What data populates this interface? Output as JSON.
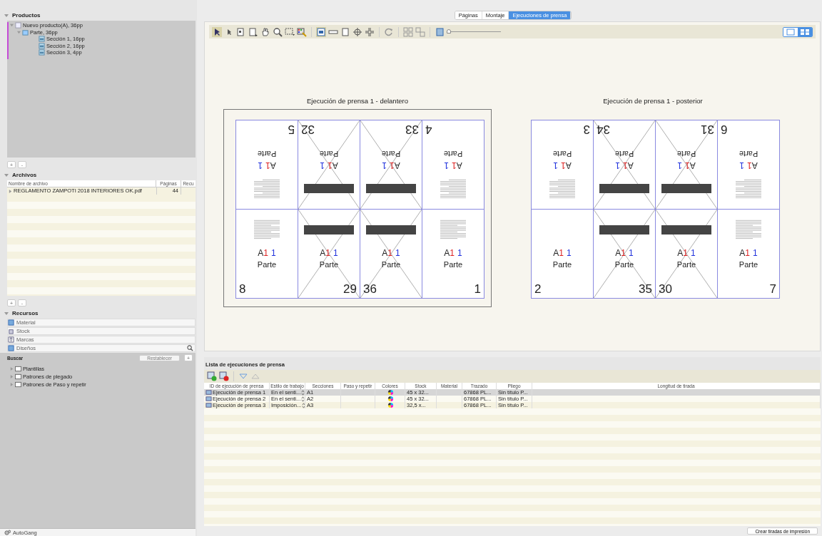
{
  "products": {
    "title": "Productos",
    "expanded": true,
    "items": [
      {
        "label": "Nuevo producto(A), 36pp",
        "expanded": true,
        "children": [
          {
            "label": "Parte, 36pp",
            "expanded": true,
            "children": [
              {
                "label": "Sección 1, 16pp"
              },
              {
                "label": "Sección 2, 16pp"
              },
              {
                "label": "Sección 3, 4pp"
              }
            ]
          }
        ]
      }
    ]
  },
  "products_buttons": [
    "+",
    "-"
  ],
  "files": {
    "title": "Archivos",
    "expanded": true,
    "columns": [
      "Nombre de archivo",
      "Páginas",
      "Recu"
    ],
    "rows": [
      {
        "name": "REGLAMENTO ZAMPOTI 2018 INTERIORES OK.pdf",
        "pages": "44"
      }
    ]
  },
  "files_buttons": [
    "+",
    "-"
  ],
  "resources": {
    "title": "Recursos",
    "expanded": true,
    "items": [
      {
        "label": "Material",
        "kind": "material"
      },
      {
        "label": "Stock",
        "kind": "stock"
      },
      {
        "label": "Marcas",
        "kind": "marks"
      },
      {
        "label": "Diseños",
        "kind": "designs"
      }
    ],
    "search_label": "Buscar",
    "reset_button": "Restablecer",
    "add_button": "+",
    "tree": [
      {
        "label": "Plantillas"
      },
      {
        "label": "Patrones de plegado"
      },
      {
        "label": "Patrones de Paso y repetir"
      }
    ]
  },
  "autogang": "AutoGang",
  "tabs": [
    {
      "label": "Páginas",
      "selected": false
    },
    {
      "label": "Montaje",
      "selected": false
    },
    {
      "label": "Ejecuciones de prensa",
      "selected": true
    }
  ],
  "zoom_slider": {
    "level": 0
  },
  "view_toggle": [
    {
      "kind": "single",
      "selected": false
    },
    {
      "kind": "grid",
      "selected": true
    }
  ],
  "sheets": [
    {
      "title": "Ejecución de prensa 1 - delantero",
      "selected": true,
      "rows": [
        {
          "rotated": true,
          "pages": [
            {
              "number": "5",
              "kind": "text",
              "part": "Parte",
              "signature": [
                "A",
                "1",
                "1"
              ]
            },
            {
              "number": "32",
              "kind": "blank",
              "part": "Parte",
              "signature": [
                "A",
                "1",
                "1"
              ]
            },
            {
              "number": "33",
              "kind": "blank",
              "part": "Parte",
              "signature": [
                "A",
                "1",
                "1"
              ]
            },
            {
              "number": "4",
              "kind": "text",
              "part": "Parte",
              "signature": [
                "A",
                "1",
                "1"
              ]
            }
          ]
        },
        {
          "rotated": false,
          "pages": [
            {
              "number": "8",
              "kind": "text",
              "part": "Parte",
              "signature": [
                "A",
                "1",
                "1"
              ]
            },
            {
              "number": "29",
              "kind": "blank",
              "part": "Parte",
              "signature": [
                "A",
                "1",
                "1"
              ]
            },
            {
              "number": "36",
              "kind": "blank",
              "part": "Parte",
              "signature": [
                "A",
                "1",
                "1"
              ]
            },
            {
              "number": "1",
              "kind": "text",
              "part": "Parte",
              "signature": [
                "A",
                "1",
                "1"
              ]
            }
          ]
        }
      ]
    },
    {
      "title": "Ejecución de prensa 1 - posterior",
      "selected": false,
      "rows": [
        {
          "rotated": true,
          "pages": [
            {
              "number": "3",
              "kind": "text",
              "part": "Parte",
              "signature": [
                "A",
                "1",
                "1"
              ]
            },
            {
              "number": "34",
              "kind": "blank",
              "part": "Parte",
              "signature": [
                "A",
                "1",
                "1"
              ]
            },
            {
              "number": "31",
              "kind": "blank",
              "part": "Parte",
              "signature": [
                "A",
                "1",
                "1"
              ]
            },
            {
              "number": "6",
              "kind": "text",
              "part": "Parte",
              "signature": [
                "A",
                "1",
                "1"
              ]
            }
          ]
        },
        {
          "rotated": false,
          "pages": [
            {
              "number": "2",
              "kind": "empty",
              "part": "Parte",
              "signature": [
                "A",
                "1",
                "1"
              ]
            },
            {
              "number": "35",
              "kind": "blank",
              "part": "Parte",
              "signature": [
                "A",
                "1",
                "1"
              ]
            },
            {
              "number": "30",
              "kind": "blank",
              "part": "Parte",
              "signature": [
                "A",
                "1",
                "1"
              ]
            },
            {
              "number": "7",
              "kind": "text",
              "part": "Parte",
              "signature": [
                "A",
                "1",
                "1"
              ]
            }
          ]
        }
      ]
    }
  ],
  "run_list": {
    "title": "Lista de ejecuciones de prensa",
    "columns": [
      "ID de ejecución de prensa",
      "Estilo de trabajo",
      "Secciones",
      "Paso y repetir",
      "Colores",
      "Stock",
      "Material",
      "Trazado",
      "Pliego",
      "Longitud de tirada"
    ],
    "rows": [
      {
        "id": "Ejecución de prensa 1",
        "style": "En el senti...",
        "sections": "A1",
        "stock": "45 x 32...",
        "layout": "67868 PL...",
        "sheet": "Sin título P...",
        "selected": true
      },
      {
        "id": "Ejecución de prensa 2",
        "style": "En el senti...",
        "sections": "A2",
        "stock": "45 x 32...",
        "layout": "67868 PL...",
        "sheet": "Sin título P...",
        "selected": false
      },
      {
        "id": "Ejecución de prensa 3",
        "style": "Imposición...",
        "sections": "A3",
        "stock": "32,5 x...",
        "layout": "67868 PL...",
        "sheet": "Sin título P...",
        "selected": false
      }
    ]
  },
  "create_button": "Crear tiradas de impresión"
}
